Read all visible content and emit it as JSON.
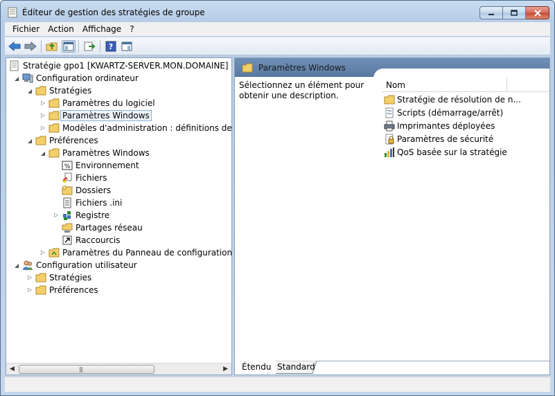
{
  "window": {
    "title": "Éditeur de gestion des stratégies de groupe"
  },
  "menu": [
    "Fichier",
    "Action",
    "Affichage",
    "?"
  ],
  "toolbar": {
    "buttons": [
      "back-arrow-icon",
      "forward-arrow-icon",
      "up-folder-icon",
      "show-hide-tree-icon",
      "export-list-icon",
      "help-icon",
      "properties-pane-icon"
    ]
  },
  "tree": {
    "root": "Stratégie gpo1 [KWARTZ-SERVER.MON.DOMAINE]",
    "computer_config": "Configuration ordinateur",
    "strategies": "Stratégies",
    "software_settings": "Paramètres du logiciel",
    "windows_settings": "Paramètres Windows",
    "admin_templates": "Modèles d'administration : définitions de stratégies",
    "preferences": "Préférences",
    "pref_windows_settings": "Paramètres Windows",
    "environment": "Environnement",
    "files": "Fichiers",
    "folders": "Dossiers",
    "ini_files": "Fichiers .ini",
    "registry": "Registre",
    "network_shares": "Partages réseau",
    "shortcuts": "Raccourcis",
    "control_panel": "Paramètres du Panneau de configuration",
    "user_config": "Configuration utilisateur",
    "user_strategies": "Stratégies",
    "user_preferences": "Préférences"
  },
  "right": {
    "header_title": "Paramètres Windows",
    "description": "Sélectionnez un élément pour obtenir une description.",
    "column_name": "Nom",
    "items": [
      "Stratégie de résolution de n...",
      "Scripts (démarrage/arrêt)",
      "Imprimantes déployées",
      "Paramètres de sécurité",
      "QoS basée sur la stratégie"
    ],
    "tabs": [
      "Étendu",
      "Standard"
    ]
  },
  "colors": {
    "header_blue": "#5a7aa2",
    "folder_yellow": "#f3cf6b",
    "title_bar": "#c4d6ec"
  }
}
